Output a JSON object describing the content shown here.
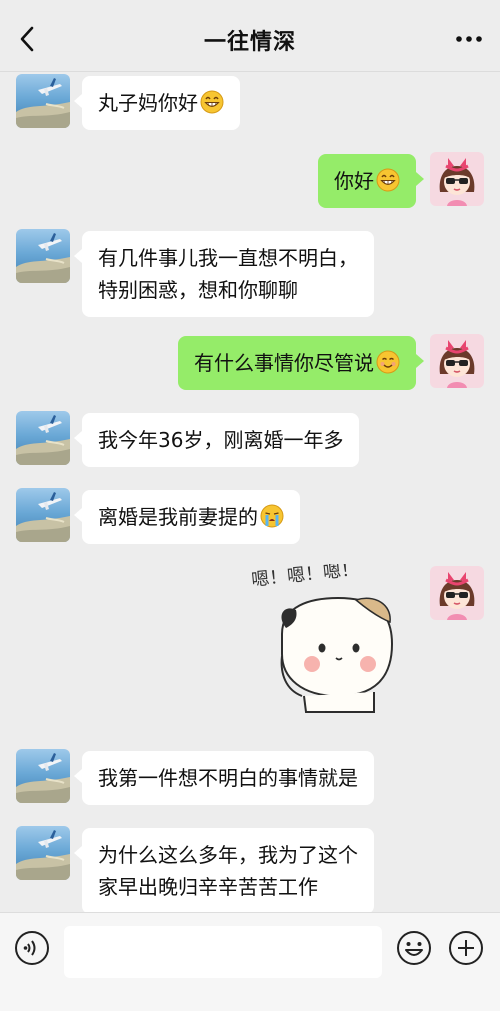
{
  "header": {
    "title": "一往情深"
  },
  "messages": [
    {
      "side": "left",
      "text": "丸子妈你好",
      "emoji": "grin-emoji"
    },
    {
      "side": "right",
      "text": "你好",
      "emoji": "grin-emoji"
    },
    {
      "side": "left",
      "text": "有几件事儿我一直想不明白，\n特别困惑，想和你聊聊"
    },
    {
      "side": "right",
      "text": "有什么事情你尽管说",
      "emoji": "smile-emoji"
    },
    {
      "side": "left",
      "text": "我今年36岁，刚离婚一年多"
    },
    {
      "side": "left",
      "text": "离婚是我前妻提的",
      "emoji": "crying-emoji"
    },
    {
      "side": "right",
      "type": "sticker",
      "sticker_text": "嗯！嗯！嗯！"
    },
    {
      "side": "left",
      "text": "我第一件想不明白的事情就是"
    },
    {
      "side": "left",
      "text": "为什么这么多年，我为了这个\n家早出晚归辛辛苦苦工作"
    }
  ],
  "input": {
    "value": ""
  },
  "colors": {
    "background": "#ededed",
    "outgoing_bubble": "#95ec69",
    "incoming_bubble": "#ffffff"
  },
  "icons": [
    "back-icon",
    "more-icon",
    "voice-icon",
    "emoji-icon",
    "plus-icon"
  ]
}
